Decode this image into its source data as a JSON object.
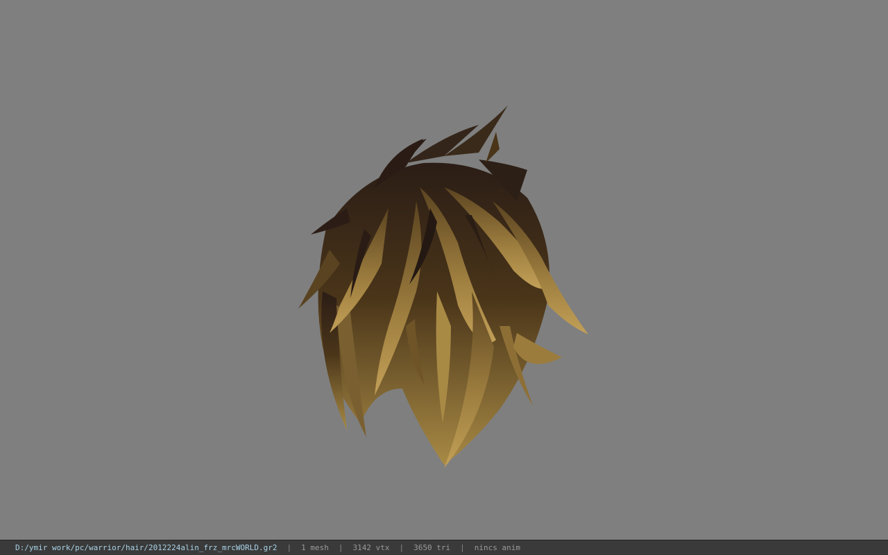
{
  "viewport": {
    "background_color": "#7f7f7f",
    "model": {
      "name": "hair mesh",
      "dark_color": "#2b1d16",
      "light_color": "#a88a45"
    }
  },
  "status_bar": {
    "file_path": "D:/ymir work/pc/warrior/hair/2012224alin_frz_mrcWORLD.gr2",
    "separator": "|",
    "mesh_count": "1 mesh",
    "vertex_count": "3142 vtx",
    "triangle_count": "3650 tri",
    "anim_status": "nincs anim"
  }
}
